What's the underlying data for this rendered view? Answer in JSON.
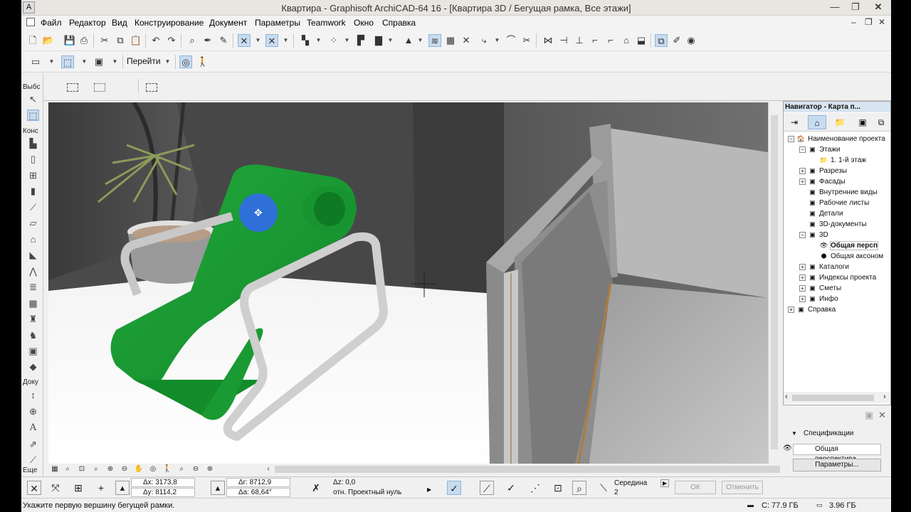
{
  "window": {
    "title": "Квартира - Graphisoft ArchiCAD-64 16 - [Квартира 3D / Бегущая рамка, Все этажи]",
    "min_glyph": "—",
    "max_glyph": "❐",
    "close_glyph": "✕"
  },
  "menu": {
    "items": [
      "Файл",
      "Редактор",
      "Вид",
      "Конструирование",
      "Документ",
      "Параметры",
      "Teamwork",
      "Окно",
      "Справка"
    ],
    "mdi": {
      "min": "–",
      "restore": "❐",
      "close": "✕"
    }
  },
  "toolbar2": {
    "goto_label": "Перейти"
  },
  "toolbox": {
    "select_label": "Выбс",
    "construct_label": "Конс",
    "document_label": "Доку",
    "more_label": "Еще",
    "icons": [
      "arrow-select",
      "marquee",
      "wall",
      "door",
      "window",
      "column",
      "beam",
      "slab",
      "roof",
      "shell",
      "mesh",
      "stair",
      "object",
      "zone",
      "curtain-wall",
      "morph",
      "dimension",
      "level-dimension",
      "text",
      "label"
    ]
  },
  "navigator": {
    "title": "Навигатор - Карта п...",
    "tree": [
      {
        "label": "Наименование проекта",
        "level": 0,
        "exp": "−",
        "icon": "house"
      },
      {
        "label": "Этажи",
        "level": 1,
        "exp": "−",
        "icon": "box"
      },
      {
        "label": "1. 1-й этаж",
        "level": 2,
        "exp": "",
        "icon": "folder"
      },
      {
        "label": "Разрезы",
        "level": 1,
        "exp": "+",
        "icon": "box"
      },
      {
        "label": "Фасады",
        "level": 1,
        "exp": "+",
        "icon": "box"
      },
      {
        "label": "Внутренние виды",
        "level": 1,
        "exp": "",
        "icon": "box"
      },
      {
        "label": "Рабочие листы",
        "level": 1,
        "exp": "",
        "icon": "box"
      },
      {
        "label": "Детали",
        "level": 1,
        "exp": "",
        "icon": "box"
      },
      {
        "label": "3D-документы",
        "level": 1,
        "exp": "",
        "icon": "box"
      },
      {
        "label": "3D",
        "level": 1,
        "exp": "−",
        "icon": "box"
      },
      {
        "label": "Общая персп",
        "level": 2,
        "exp": "",
        "icon": "eye",
        "selected": true
      },
      {
        "label": "Общая аксоном",
        "level": 2,
        "exp": "",
        "icon": "cube"
      },
      {
        "label": "Каталоги",
        "level": 1,
        "exp": "+",
        "icon": "box"
      },
      {
        "label": "Индексы проекта",
        "level": 1,
        "exp": "+",
        "icon": "box"
      },
      {
        "label": "Сметы",
        "level": 1,
        "exp": "+",
        "icon": "box"
      },
      {
        "label": "Инфо",
        "level": 1,
        "exp": "+",
        "icon": "box"
      },
      {
        "label": "Справка",
        "level": 0,
        "exp": "+",
        "icon": "box"
      }
    ]
  },
  "specs": {
    "header": "Спецификации",
    "view_name": "Общая перспектива",
    "params_button": "Параметры..."
  },
  "coords": {
    "dx": "Δx: 3173,8",
    "dy": "Δy: 8114,2",
    "dr": "Δr: 8712,9",
    "da": "Δa: 68,64°",
    "dz": "Δz: 0,0",
    "ref": "отн. Проектный нуль",
    "midpoint": "Середина",
    "midpoint_num": "2",
    "ok": "ОК",
    "cancel": "Отменить"
  },
  "status": {
    "hint": "Укажите первую вершину бегущей рамки.",
    "disk": "C: 77.9 ГБ",
    "mem": "3.96 ГБ"
  },
  "colors": {
    "chair_green": "#1e9a34",
    "cursor_blue": "#2f6fd8",
    "panel": "#f0f0f0"
  }
}
